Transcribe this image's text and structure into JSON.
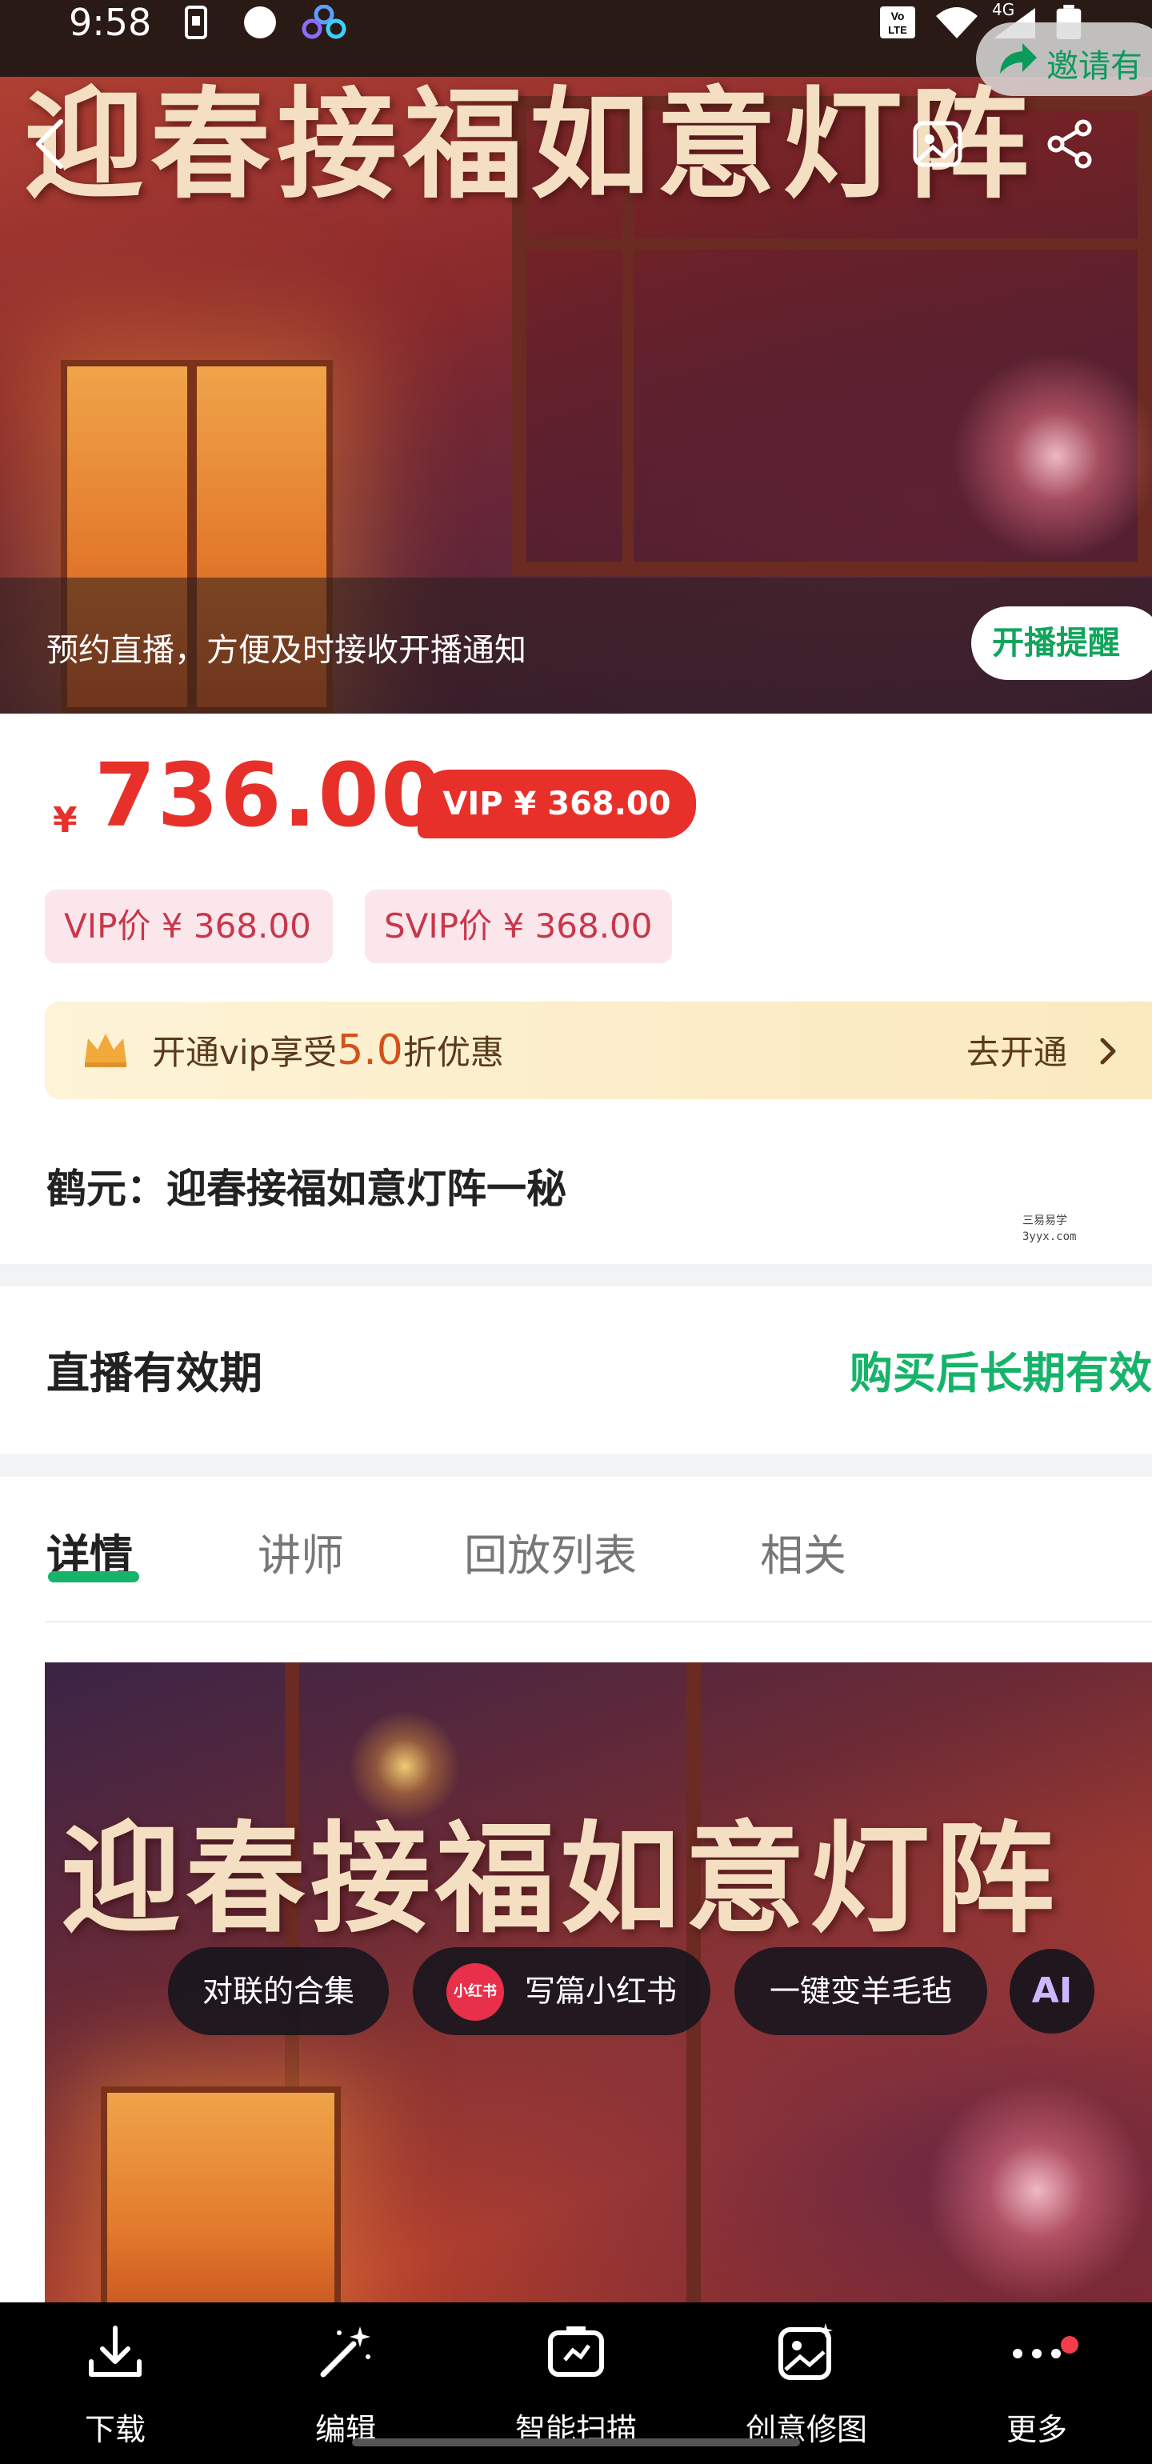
{
  "status_bar": {
    "time": "9:58",
    "network": "4G"
  },
  "invite_label": "邀请有",
  "hero": {
    "title": "迎春接福如意灯阵",
    "notice_text": "预约直播，方便及时接收开播通知",
    "remind_button": "开播提醒"
  },
  "price": {
    "symbol": "¥",
    "amount": "736.00",
    "vip_badge": "VIP ¥ 368.00",
    "vip_tag": "VIP价 ¥ 368.00",
    "svip_tag": "SVIP价 ¥ 368.00"
  },
  "vip_promo": {
    "prefix": "开通vip享受",
    "discount": "5.0",
    "suffix": "折优惠",
    "action": "去开通"
  },
  "course_title": "鹤元：迎春接福如意灯阵一秘",
  "watermark": {
    "line1": "三易易学",
    "line2": "3yyx.com"
  },
  "validity": {
    "label": "直播有效期",
    "value": "购买后长期有效"
  },
  "tabs": [
    {
      "label": "详情",
      "active": true
    },
    {
      "label": "讲师",
      "active": false
    },
    {
      "label": "回放列表",
      "active": false
    },
    {
      "label": "相关",
      "active": false
    }
  ],
  "poster": {
    "title": "迎春接福如意灯阵"
  },
  "ai_chips": {
    "chip1": "对联的合集",
    "chip2_icon_text": "小红书",
    "chip2": "写篇小红书",
    "chip3": "一键变羊毛毡",
    "ai_button": "AI"
  },
  "toolbar": [
    {
      "label": "下载",
      "icon": "download-icon"
    },
    {
      "label": "编辑",
      "icon": "magic-wand-icon"
    },
    {
      "label": "智能扫描",
      "icon": "smart-scan-icon"
    },
    {
      "label": "创意修图",
      "icon": "creative-photo-icon"
    },
    {
      "label": "更多",
      "icon": "more-icon"
    }
  ],
  "colors": {
    "price_red": "#e8302a",
    "accent_green": "#16b36a",
    "vip_gold": "#fbe9bf"
  }
}
